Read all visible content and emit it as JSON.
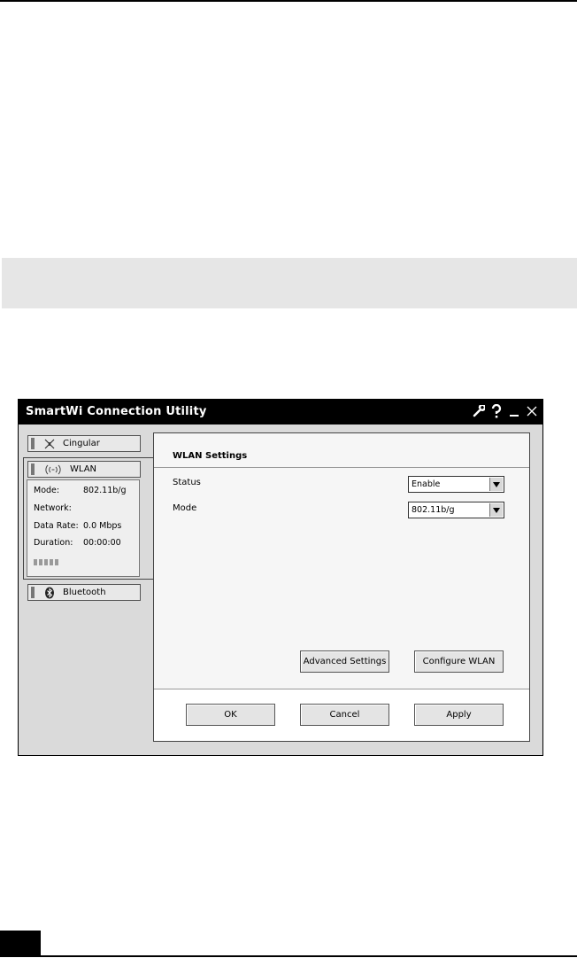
{
  "window": {
    "title": "SmartWi Connection Utility",
    "controls": [
      "wrench-icon",
      "help-icon",
      "minimize-icon",
      "close-icon"
    ]
  },
  "sidebar": {
    "items": [
      {
        "label": "Cingular",
        "icon": "cellular-icon"
      },
      {
        "label": "WLAN",
        "icon": "wifi-icon"
      },
      {
        "label": "Bluetooth",
        "icon": "bluetooth-icon"
      }
    ],
    "wlan_status": {
      "mode_label": "Mode:",
      "mode_value": "802.11b/g",
      "network_label": "Network:",
      "network_value": "",
      "rate_label": "Data Rate:",
      "rate_value": "0.0 Mbps",
      "duration_label": "Duration:",
      "duration_value": "00:00:00",
      "signal_bars": 5
    }
  },
  "settings": {
    "title": "WLAN Settings",
    "status_label": "Status",
    "status_value": "Enable",
    "mode_label": "Mode",
    "mode_value": "802.11b/g",
    "advanced_label": "Advanced Settings",
    "configure_label": "Configure WLAN"
  },
  "footer": {
    "ok_label": "OK",
    "cancel_label": "Cancel",
    "apply_label": "Apply"
  }
}
